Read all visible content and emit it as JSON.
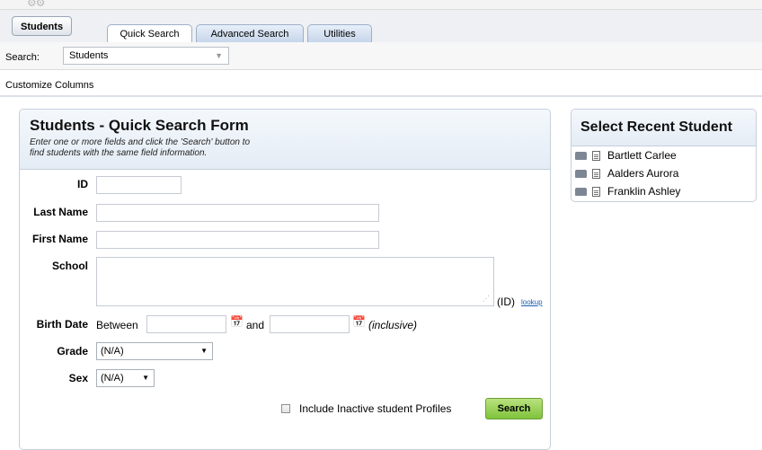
{
  "header": {
    "students_button": "Students",
    "tabs": [
      {
        "label": "Quick Search",
        "active": true
      },
      {
        "label": "Advanced Search",
        "active": false
      },
      {
        "label": "Utilities",
        "active": false
      }
    ]
  },
  "search": {
    "label": "Search:",
    "selected": "Students"
  },
  "toolbar": {
    "customize_columns": "Customize Columns"
  },
  "form": {
    "title": "Students - Quick Search Form",
    "description_line1": "Enter one or more fields and click the 'Search' button to",
    "description_line2": "find students with the same field information.",
    "fields": {
      "id_label": "ID",
      "last_name_label": "Last Name",
      "first_name_label": "First Name",
      "school_label": "School",
      "school_suffix": "(ID)",
      "lookup_link": "lookup",
      "birth_date_label": "Birth Date",
      "between": "Between",
      "and": "and",
      "inclusive": "(inclusive)",
      "grade_label": "Grade",
      "grade_value": "(N/A)",
      "sex_label": "Sex",
      "sex_value": "(N/A)"
    },
    "include_inactive": "Include Inactive student Profiles",
    "search_button": "Search"
  },
  "recent": {
    "title": "Select Recent Student",
    "students": [
      "Bartlett Carlee",
      "Aalders Aurora",
      "Franklin Ashley"
    ]
  }
}
